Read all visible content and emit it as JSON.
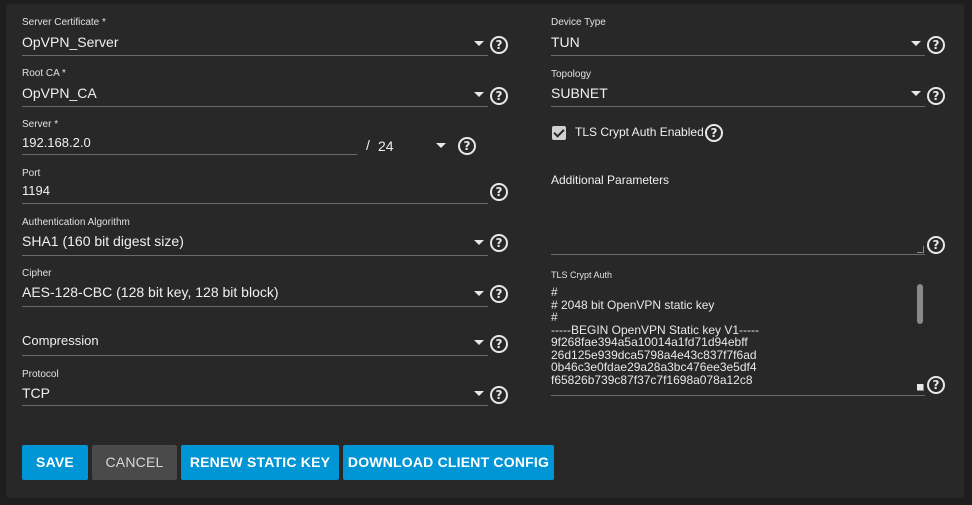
{
  "server_certificate": {
    "label": "Server Certificate *",
    "value": "OpVPN_Server"
  },
  "root_ca": {
    "label": "Root CA *",
    "value": "OpVPN_CA"
  },
  "server": {
    "label": "Server *",
    "value": "192.168.2.0",
    "separator": "/",
    "netmask": "24"
  },
  "port": {
    "label": "Port",
    "value": "1194"
  },
  "auth_algorithm": {
    "label": "Authentication Algorithm",
    "value": "SHA1 (160 bit digest size)"
  },
  "cipher": {
    "label": "Cipher",
    "value": "AES-128-CBC (128 bit key, 128 bit block)"
  },
  "compression": {
    "placeholder": "Compression"
  },
  "protocol": {
    "label": "Protocol",
    "value": "TCP"
  },
  "device_type": {
    "label": "Device Type",
    "value": "TUN"
  },
  "topology": {
    "label": "Topology",
    "value": "SUBNET"
  },
  "tls_crypt_auth_enabled": {
    "label": "TLS Crypt Auth Enabled",
    "checked": true
  },
  "additional_parameters": {
    "placeholder": "Additional Parameters",
    "value": ""
  },
  "tls_crypt_auth": {
    "label": "TLS Crypt Auth",
    "lines": [
      "#",
      "# 2048 bit OpenVPN static key",
      "#",
      "-----BEGIN OpenVPN Static key V1-----",
      "9f268fae394a5a10014a1fd71d94ebff",
      "26d125e939dca5798a4e43c837f7f6ad",
      "0b46c3e0fdae29a28a3bc476ee3e5df4",
      "f65826b739c87f37c7f1698a078a12c8"
    ]
  },
  "buttons": {
    "save": "SAVE",
    "cancel": "CANCEL",
    "renew": "RENEW STATIC KEY",
    "download": "DOWNLOAD CLIENT CONFIG"
  },
  "icons": {
    "help": "help-circle-icon",
    "dropdown": "caret-down-icon",
    "check": "checkbox-checked-icon"
  },
  "colors": {
    "accent": "#0095d5",
    "panel": "#282828",
    "background": "#1e1e1e"
  }
}
